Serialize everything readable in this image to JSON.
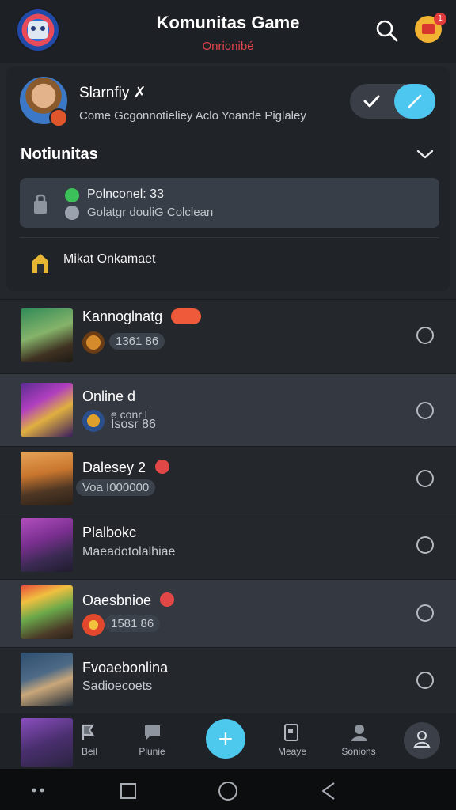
{
  "header": {
    "title": "Komunitas Game",
    "subtitle": "Onrionibé",
    "notification_count": "1"
  },
  "profile": {
    "name": "Slarnfiy ✗",
    "description": "Come Gcgonnotieliey Aclo Yoande Piglaley"
  },
  "section": {
    "title": "Notiunitas"
  },
  "notice": {
    "line1": "Polnconel: 33",
    "line2": "Golatgr douliG Colclean"
  },
  "market": {
    "label": "Mikat Onkamaet"
  },
  "games": [
    {
      "title": "Kannoglnatg",
      "sub": "1361 86"
    },
    {
      "title": "Online d",
      "sub": "Isosr 86",
      "sub_top": "e conr l"
    },
    {
      "title": "Dalesey 2",
      "sub": "Voa I000000"
    },
    {
      "title": "Plalbokc",
      "sub": "Maeadotolalhiae"
    },
    {
      "title": "Oaesbnioe",
      "sub": "1581 86"
    },
    {
      "title": "Fvoaebonlina",
      "sub": "Sadioecoets"
    }
  ],
  "bottom_nav": [
    {
      "label": "Beil"
    },
    {
      "label": "Plunie"
    },
    {
      "label": "Meaye"
    },
    {
      "label": "Sonions"
    }
  ],
  "colors": {
    "accent": "#4dc9ee",
    "subtitle_red": "#e0444d",
    "background": "#24272c"
  }
}
